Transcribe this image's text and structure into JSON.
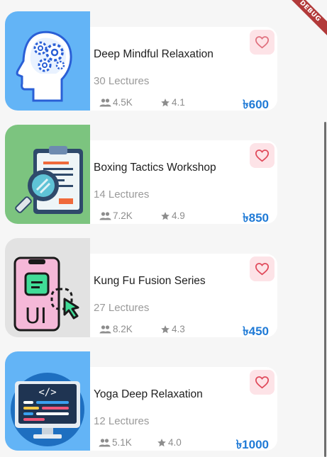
{
  "currency_symbol": "৳",
  "debug_banner": "DEBUG",
  "colors": {
    "price": "#1f7ad6",
    "favorite_bg": "#fde3e7",
    "favorite_icon": "#e0495a",
    "thumb_blue": "#63b4f6",
    "thumb_green": "#7cc47f",
    "thumb_gray": "#e2e2e2"
  },
  "courses": [
    {
      "title": "Deep Mindful Relaxation",
      "lectures": "30 Lectures",
      "students": "4.5K",
      "rating": "4.1",
      "price": "৳600",
      "icon": "brain-gears-icon"
    },
    {
      "title": "Boxing Tactics Workshop",
      "lectures": "14 Lectures",
      "students": "7.2K",
      "rating": "4.9",
      "price": "৳850",
      "icon": "clipboard-magnifier-icon"
    },
    {
      "title": "Kung Fu Fusion Series",
      "lectures": "27 Lectures",
      "students": "8.2K",
      "rating": "4.3",
      "price": "৳450",
      "icon": "phone-ui-design-icon"
    },
    {
      "title": "Yoga Deep Relaxation",
      "lectures": "12 Lectures",
      "students": "5.1K",
      "rating": "4.0",
      "price": "৳1000",
      "icon": "monitor-code-icon"
    }
  ]
}
